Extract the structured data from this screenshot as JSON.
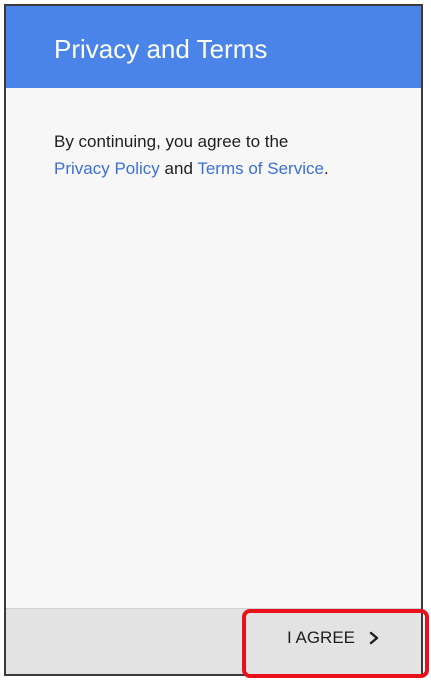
{
  "header": {
    "title": "Privacy and Terms"
  },
  "content": {
    "intro": "By continuing, you agree to the",
    "privacy_link": "Privacy Policy",
    "conjunction": "and",
    "terms_link": "Terms of Service",
    "period": "."
  },
  "footer": {
    "agree_label": "I AGREE",
    "agree_icon": "chevron-right-icon"
  },
  "colors": {
    "header_bg": "#4a84e8",
    "link": "#3d6fd6",
    "highlight": "#e8101a"
  }
}
